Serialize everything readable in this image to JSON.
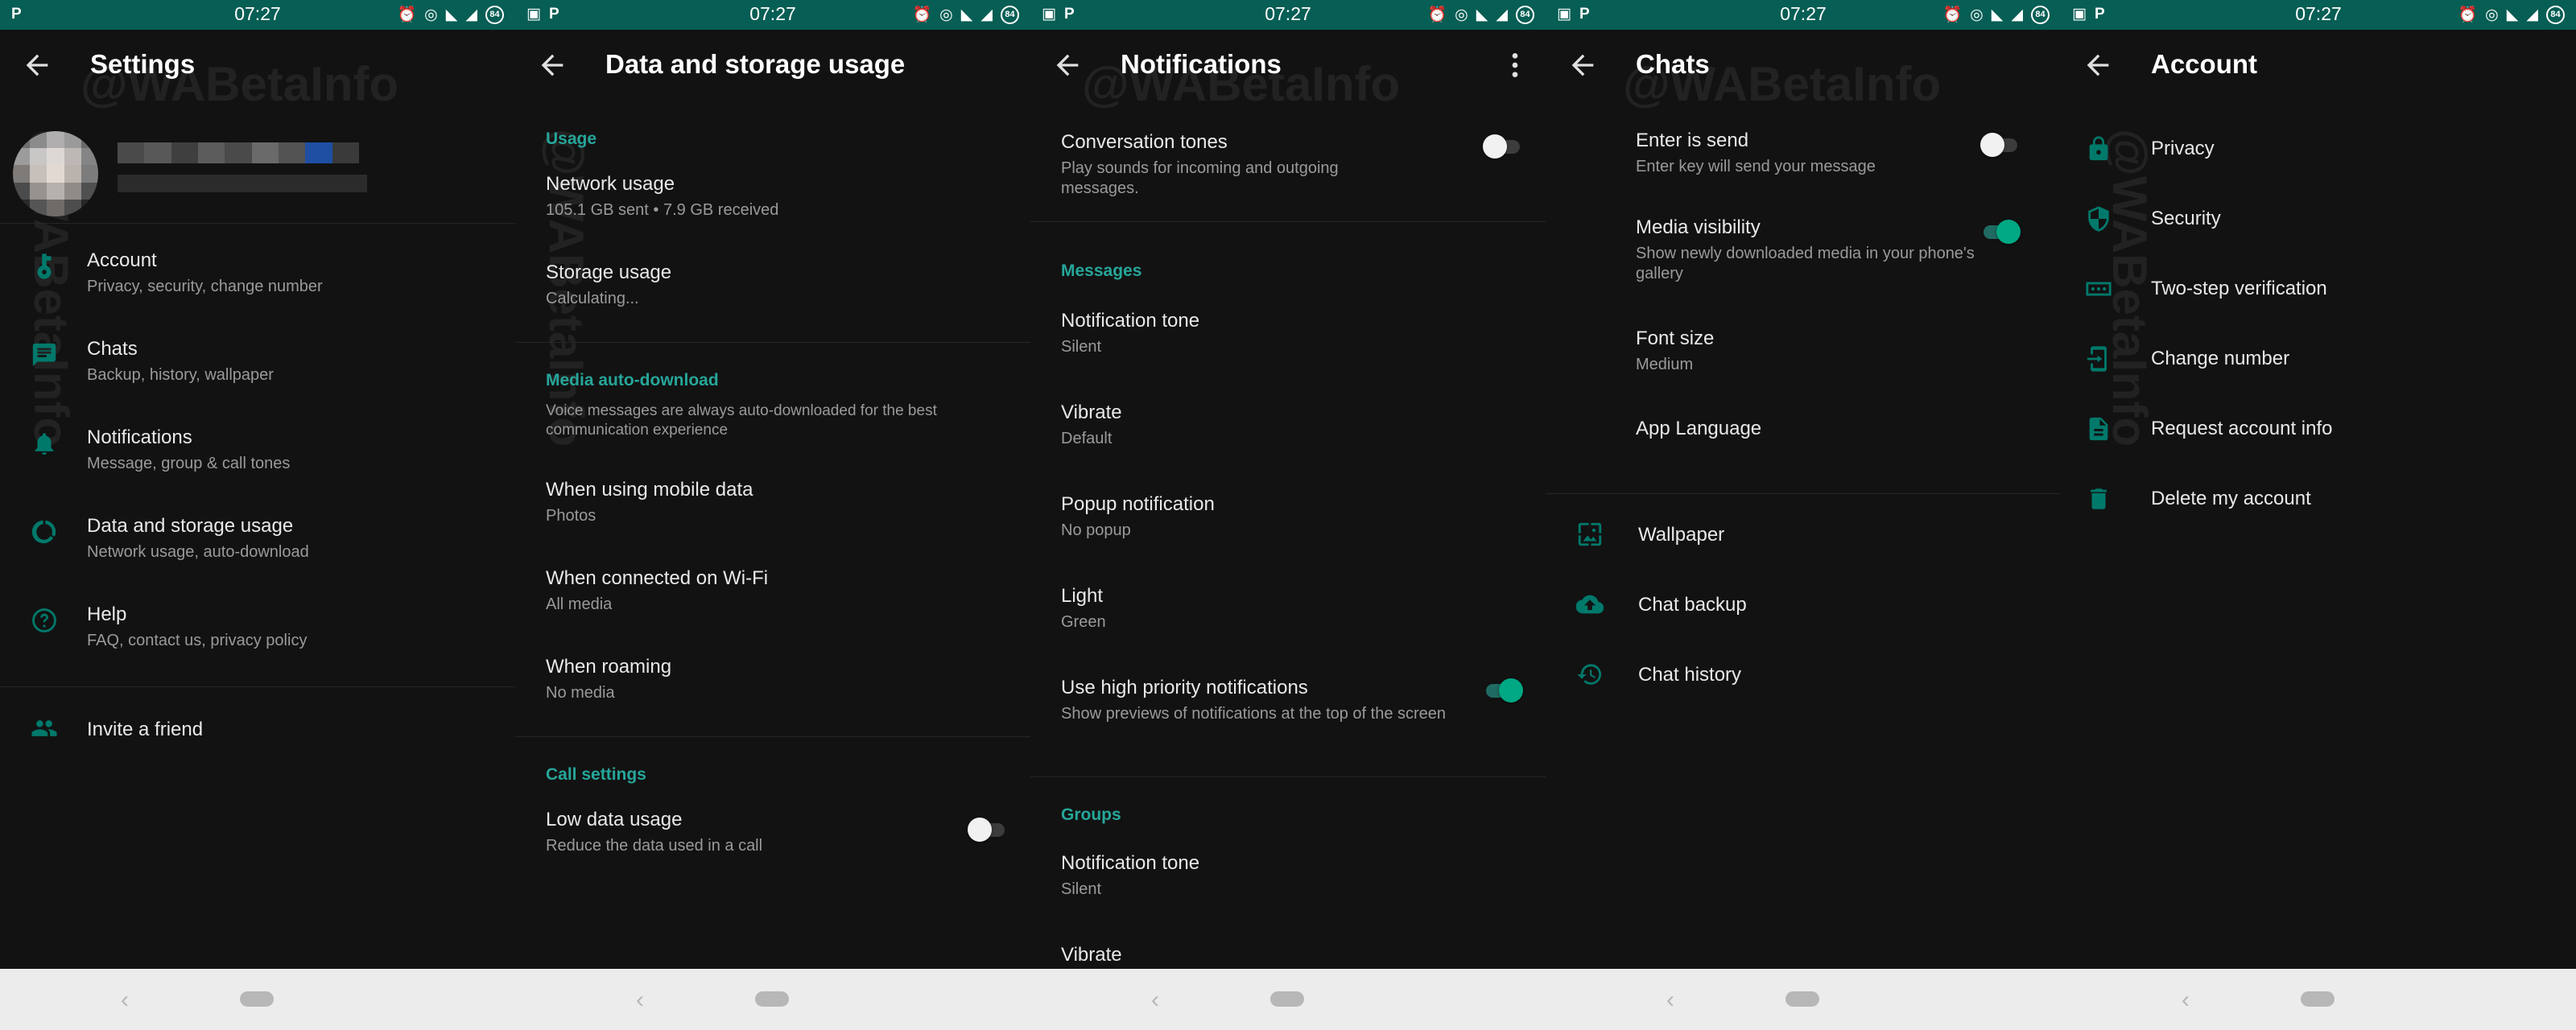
{
  "status_bar": {
    "time": "07:27",
    "battery": "84"
  },
  "watermark": "@WABetaInfo",
  "screens": {
    "settings": {
      "title": "Settings",
      "items": [
        {
          "title": "Account",
          "subtitle": "Privacy, security, change number",
          "icon": "key-icon"
        },
        {
          "title": "Chats",
          "subtitle": "Backup, history, wallpaper",
          "icon": "chat-icon"
        },
        {
          "title": "Notifications",
          "subtitle": "Message, group & call tones",
          "icon": "bell-icon"
        },
        {
          "title": "Data and storage usage",
          "subtitle": "Network usage, auto-download",
          "icon": "data-usage-icon"
        },
        {
          "title": "Help",
          "subtitle": "FAQ, contact us, privacy policy",
          "icon": "help-icon"
        }
      ],
      "invite": {
        "title": "Invite a friend",
        "icon": "people-icon"
      }
    },
    "data_storage": {
      "title": "Data and storage usage",
      "usage_header": "Usage",
      "network_usage": {
        "title": "Network usage",
        "subtitle": "105.1 GB sent • 7.9 GB received"
      },
      "storage_usage": {
        "title": "Storage usage",
        "subtitle": "Calculating..."
      },
      "auto_download_header": "Media auto-download",
      "auto_download_desc": "Voice messages are always auto-downloaded for the best communication experience",
      "mobile_data": {
        "title": "When using mobile data",
        "subtitle": "Photos"
      },
      "wifi": {
        "title": "When connected on Wi-Fi",
        "subtitle": "All media"
      },
      "roaming": {
        "title": "When roaming",
        "subtitle": "No media"
      },
      "call_header": "Call settings",
      "low_data": {
        "title": "Low data usage",
        "subtitle": "Reduce the data used in a call",
        "on": false
      }
    },
    "notifications": {
      "title": "Notifications",
      "conversation_tones": {
        "title": "Conversation tones",
        "subtitle": "Play sounds for incoming and outgoing messages.",
        "on": false
      },
      "messages_header": "Messages",
      "msg_tone": {
        "title": "Notification tone",
        "subtitle": "Silent"
      },
      "msg_vibrate": {
        "title": "Vibrate",
        "subtitle": "Default"
      },
      "msg_popup": {
        "title": "Popup notification",
        "subtitle": "No popup"
      },
      "msg_light": {
        "title": "Light",
        "subtitle": "Green"
      },
      "high_priority": {
        "title": "Use high priority notifications",
        "subtitle": "Show previews of notifications at the top of the screen",
        "on": true
      },
      "groups_header": "Groups",
      "grp_tone": {
        "title": "Notification tone",
        "subtitle": "Silent"
      },
      "grp_vibrate": {
        "title": "Vibrate"
      }
    },
    "chats": {
      "title": "Chats",
      "enter_send": {
        "title": "Enter is send",
        "subtitle": "Enter key will send your message",
        "on": false
      },
      "media_visibility": {
        "title": "Media visibility",
        "subtitle": "Show newly downloaded media in your phone's gallery",
        "on": true
      },
      "font_size": {
        "title": "Font size",
        "subtitle": "Medium"
      },
      "app_language": {
        "title": "App Language"
      },
      "wallpaper": {
        "title": "Wallpaper",
        "icon": "wallpaper-icon"
      },
      "backup": {
        "title": "Chat backup",
        "icon": "cloud-upload-icon"
      },
      "history": {
        "title": "Chat history",
        "icon": "history-icon"
      }
    },
    "account": {
      "title": "Account",
      "items": [
        {
          "title": "Privacy",
          "icon": "lock-icon"
        },
        {
          "title": "Security",
          "icon": "shield-icon"
        },
        {
          "title": "Two-step verification",
          "icon": "dots-icon"
        },
        {
          "title": "Change number",
          "icon": "change-number-icon"
        },
        {
          "title": "Request account info",
          "icon": "document-icon"
        },
        {
          "title": "Delete my account",
          "icon": "trash-icon"
        }
      ]
    }
  },
  "colors": {
    "status_bar": "#075e54",
    "accent": "#26a69a",
    "icon": "#00796b",
    "background": "#121212",
    "nav_bar": "#ececec"
  }
}
